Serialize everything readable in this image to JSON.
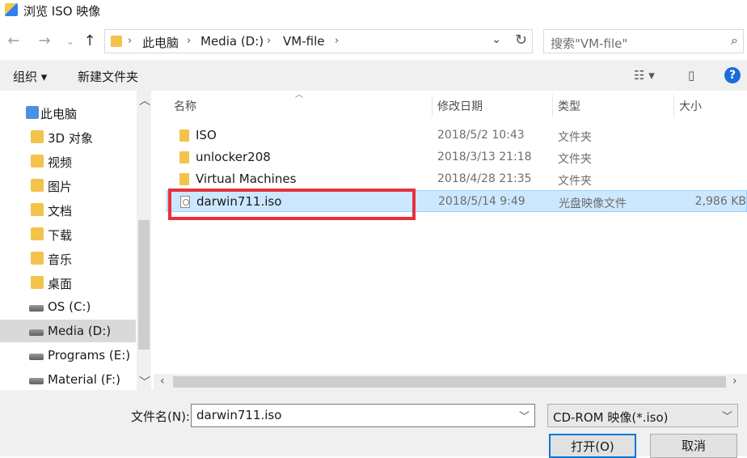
{
  "window": {
    "title": "浏览 ISO 映像"
  },
  "nav": {
    "back": "←",
    "forward": "→",
    "recent": "⌄",
    "up": "↑",
    "breadcrumbs": [
      "此电脑",
      "Media (D:)",
      "VM-file"
    ],
    "search_placeholder": "搜索\"VM-file\""
  },
  "toolbar": {
    "organize": "组织 ▾",
    "new_folder": "新建文件夹",
    "help": "?"
  },
  "sidebar": {
    "items": [
      {
        "label": "此电脑",
        "icon": "computer-icon"
      },
      {
        "label": "3D 对象",
        "icon": "folder-icon"
      },
      {
        "label": "视频",
        "icon": "video-folder-icon"
      },
      {
        "label": "图片",
        "icon": "pictures-folder-icon"
      },
      {
        "label": "文档",
        "icon": "documents-folder-icon"
      },
      {
        "label": "下载",
        "icon": "downloads-folder-icon"
      },
      {
        "label": "音乐",
        "icon": "music-folder-icon"
      },
      {
        "label": "桌面",
        "icon": "desktop-folder-icon"
      },
      {
        "label": "OS (C:)",
        "icon": "windows-drive-icon"
      },
      {
        "label": "Media (D:)",
        "icon": "drive-icon"
      },
      {
        "label": "Programs (E:)",
        "icon": "drive-icon"
      },
      {
        "label": "Material (F:)",
        "icon": "drive-icon"
      }
    ],
    "selected_index": 9
  },
  "columns": {
    "name": "名称",
    "date": "修改日期",
    "type": "类型",
    "size": "大小"
  },
  "files": [
    {
      "name": "ISO",
      "date": "2018/5/2 10:43",
      "type": "文件夹",
      "size": ""
    },
    {
      "name": "unlocker208",
      "date": "2018/3/13 21:18",
      "type": "文件夹",
      "size": ""
    },
    {
      "name": "Virtual Machines",
      "date": "2018/4/28 21:35",
      "type": "文件夹",
      "size": ""
    },
    {
      "name": "darwin711.iso",
      "date": "2018/5/14 9:49",
      "type": "光盘映像文件",
      "size": "2,986 KB"
    }
  ],
  "selected_file_index": 3,
  "footer": {
    "filename_label": "文件名(N):",
    "filename_value": "darwin711.iso",
    "filter_value": "CD-ROM 映像(*.iso)",
    "open_label": "打开(O)",
    "cancel_label": "取消"
  },
  "colors": {
    "highlight_box": "#e6323c",
    "selection": "#cce8ff",
    "help": "#1c6cd6"
  }
}
